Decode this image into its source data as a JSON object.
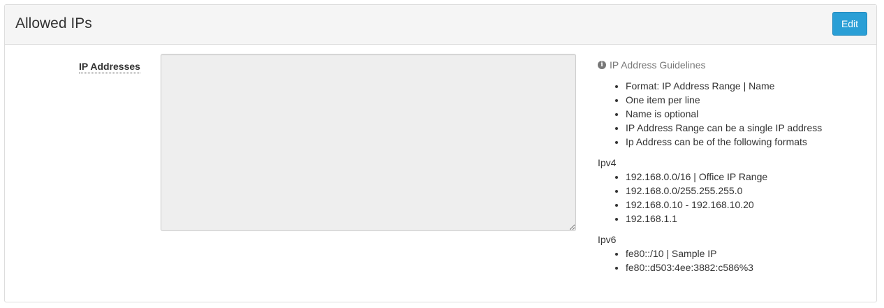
{
  "panel": {
    "title": "Allowed IPs",
    "edit_label": "Edit"
  },
  "form": {
    "field_label": "IP Addresses",
    "textarea_value": ""
  },
  "guidelines": {
    "icon": "info-icon",
    "title": "IP Address Guidelines",
    "rules": [
      "Format: IP Address Range | Name",
      "One item per line",
      "Name is optional",
      "IP Address Range can be a single IP address",
      "Ip Address can be of the following formats"
    ],
    "ipv4_label": "Ipv4",
    "ipv4_examples": [
      "192.168.0.0/16 | Office IP Range",
      "192.168.0.0/255.255.255.0",
      "192.168.0.10 - 192.168.10.20",
      "192.168.1.1"
    ],
    "ipv6_label": "Ipv6",
    "ipv6_examples": [
      "fe80::/10 | Sample IP",
      "fe80::d503:4ee:3882:c586%3"
    ]
  },
  "colors": {
    "accent": "#2a9fd6",
    "heading_bg": "#f5f5f5",
    "textarea_bg": "#eeeeee"
  }
}
